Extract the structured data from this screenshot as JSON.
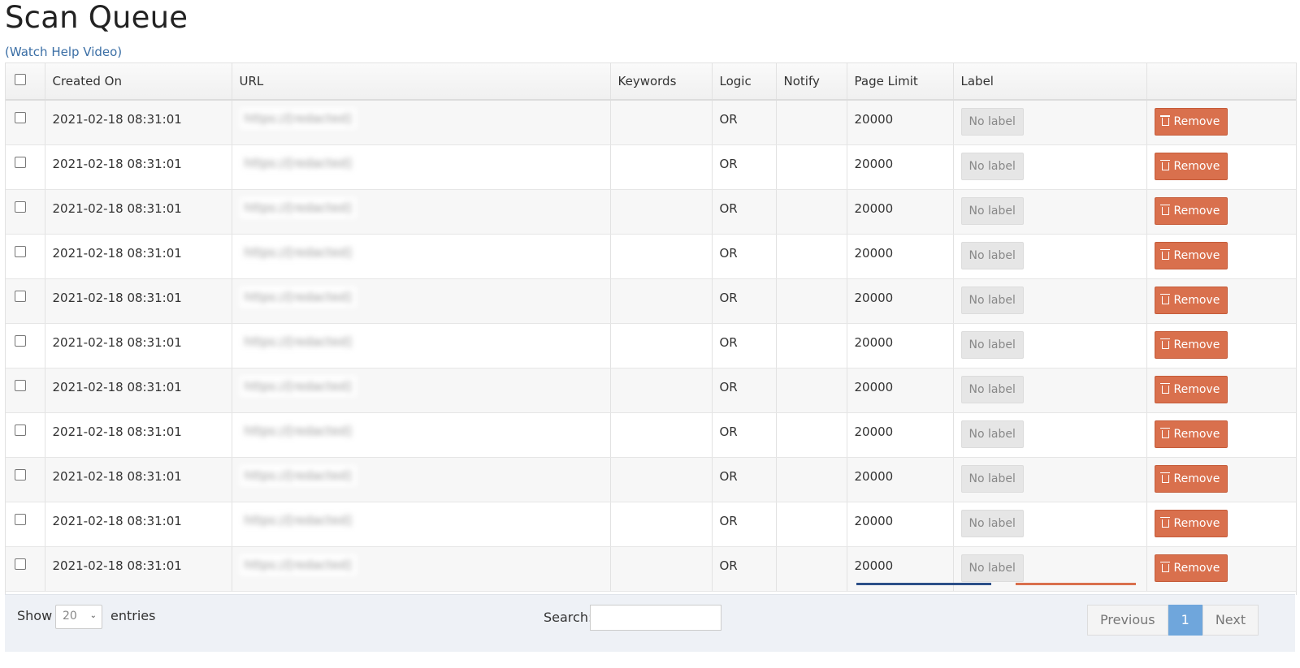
{
  "page": {
    "title": "Scan Queue",
    "help_link": "(Watch Help Video)"
  },
  "table": {
    "columns": [
      "",
      "Created On",
      "URL",
      "Keywords",
      "Logic",
      "Notify",
      "Page Limit",
      "Label",
      ""
    ],
    "rows": [
      {
        "created_on": "2021-02-18 08:31:01",
        "url": "https://[redacted]",
        "keywords": "",
        "logic": "OR",
        "notify": "",
        "page_limit": "20000",
        "label": "No label",
        "action": "Remove"
      },
      {
        "created_on": "2021-02-18 08:31:01",
        "url": "https://[redacted]",
        "keywords": "",
        "logic": "OR",
        "notify": "",
        "page_limit": "20000",
        "label": "No label",
        "action": "Remove"
      },
      {
        "created_on": "2021-02-18 08:31:01",
        "url": "https://[redacted]",
        "keywords": "",
        "logic": "OR",
        "notify": "",
        "page_limit": "20000",
        "label": "No label",
        "action": "Remove"
      },
      {
        "created_on": "2021-02-18 08:31:01",
        "url": "https://[redacted]",
        "keywords": "",
        "logic": "OR",
        "notify": "",
        "page_limit": "20000",
        "label": "No label",
        "action": "Remove"
      },
      {
        "created_on": "2021-02-18 08:31:01",
        "url": "https://[redacted]",
        "keywords": "",
        "logic": "OR",
        "notify": "",
        "page_limit": "20000",
        "label": "No label",
        "action": "Remove"
      },
      {
        "created_on": "2021-02-18 08:31:01",
        "url": "https://[redacted]",
        "keywords": "",
        "logic": "OR",
        "notify": "",
        "page_limit": "20000",
        "label": "No label",
        "action": "Remove"
      },
      {
        "created_on": "2021-02-18 08:31:01",
        "url": "https://[redacted]",
        "keywords": "",
        "logic": "OR",
        "notify": "",
        "page_limit": "20000",
        "label": "No label",
        "action": "Remove"
      },
      {
        "created_on": "2021-02-18 08:31:01",
        "url": "https://[redacted]",
        "keywords": "",
        "logic": "OR",
        "notify": "",
        "page_limit": "20000",
        "label": "No label",
        "action": "Remove"
      },
      {
        "created_on": "2021-02-18 08:31:01",
        "url": "https://[redacted]",
        "keywords": "",
        "logic": "OR",
        "notify": "",
        "page_limit": "20000",
        "label": "No label",
        "action": "Remove"
      },
      {
        "created_on": "2021-02-18 08:31:01",
        "url": "https://[redacted]",
        "keywords": "",
        "logic": "OR",
        "notify": "",
        "page_limit": "20000",
        "label": "No label",
        "action": "Remove"
      },
      {
        "created_on": "2021-02-18 08:31:01",
        "url": "https://[redacted]",
        "keywords": "",
        "logic": "OR",
        "notify": "",
        "page_limit": "20000",
        "label": "No label",
        "action": "Remove"
      }
    ]
  },
  "footer": {
    "show_label": "Show",
    "entries_value": "20",
    "entries_label": "entries",
    "search_label": "Search:",
    "search_value": "",
    "pagination": {
      "previous": "Previous",
      "current": "1",
      "next": "Next"
    }
  },
  "colors": {
    "remove_button": "#d9704d",
    "active_page": "#6fa6dc",
    "link": "#3a6ea5"
  }
}
